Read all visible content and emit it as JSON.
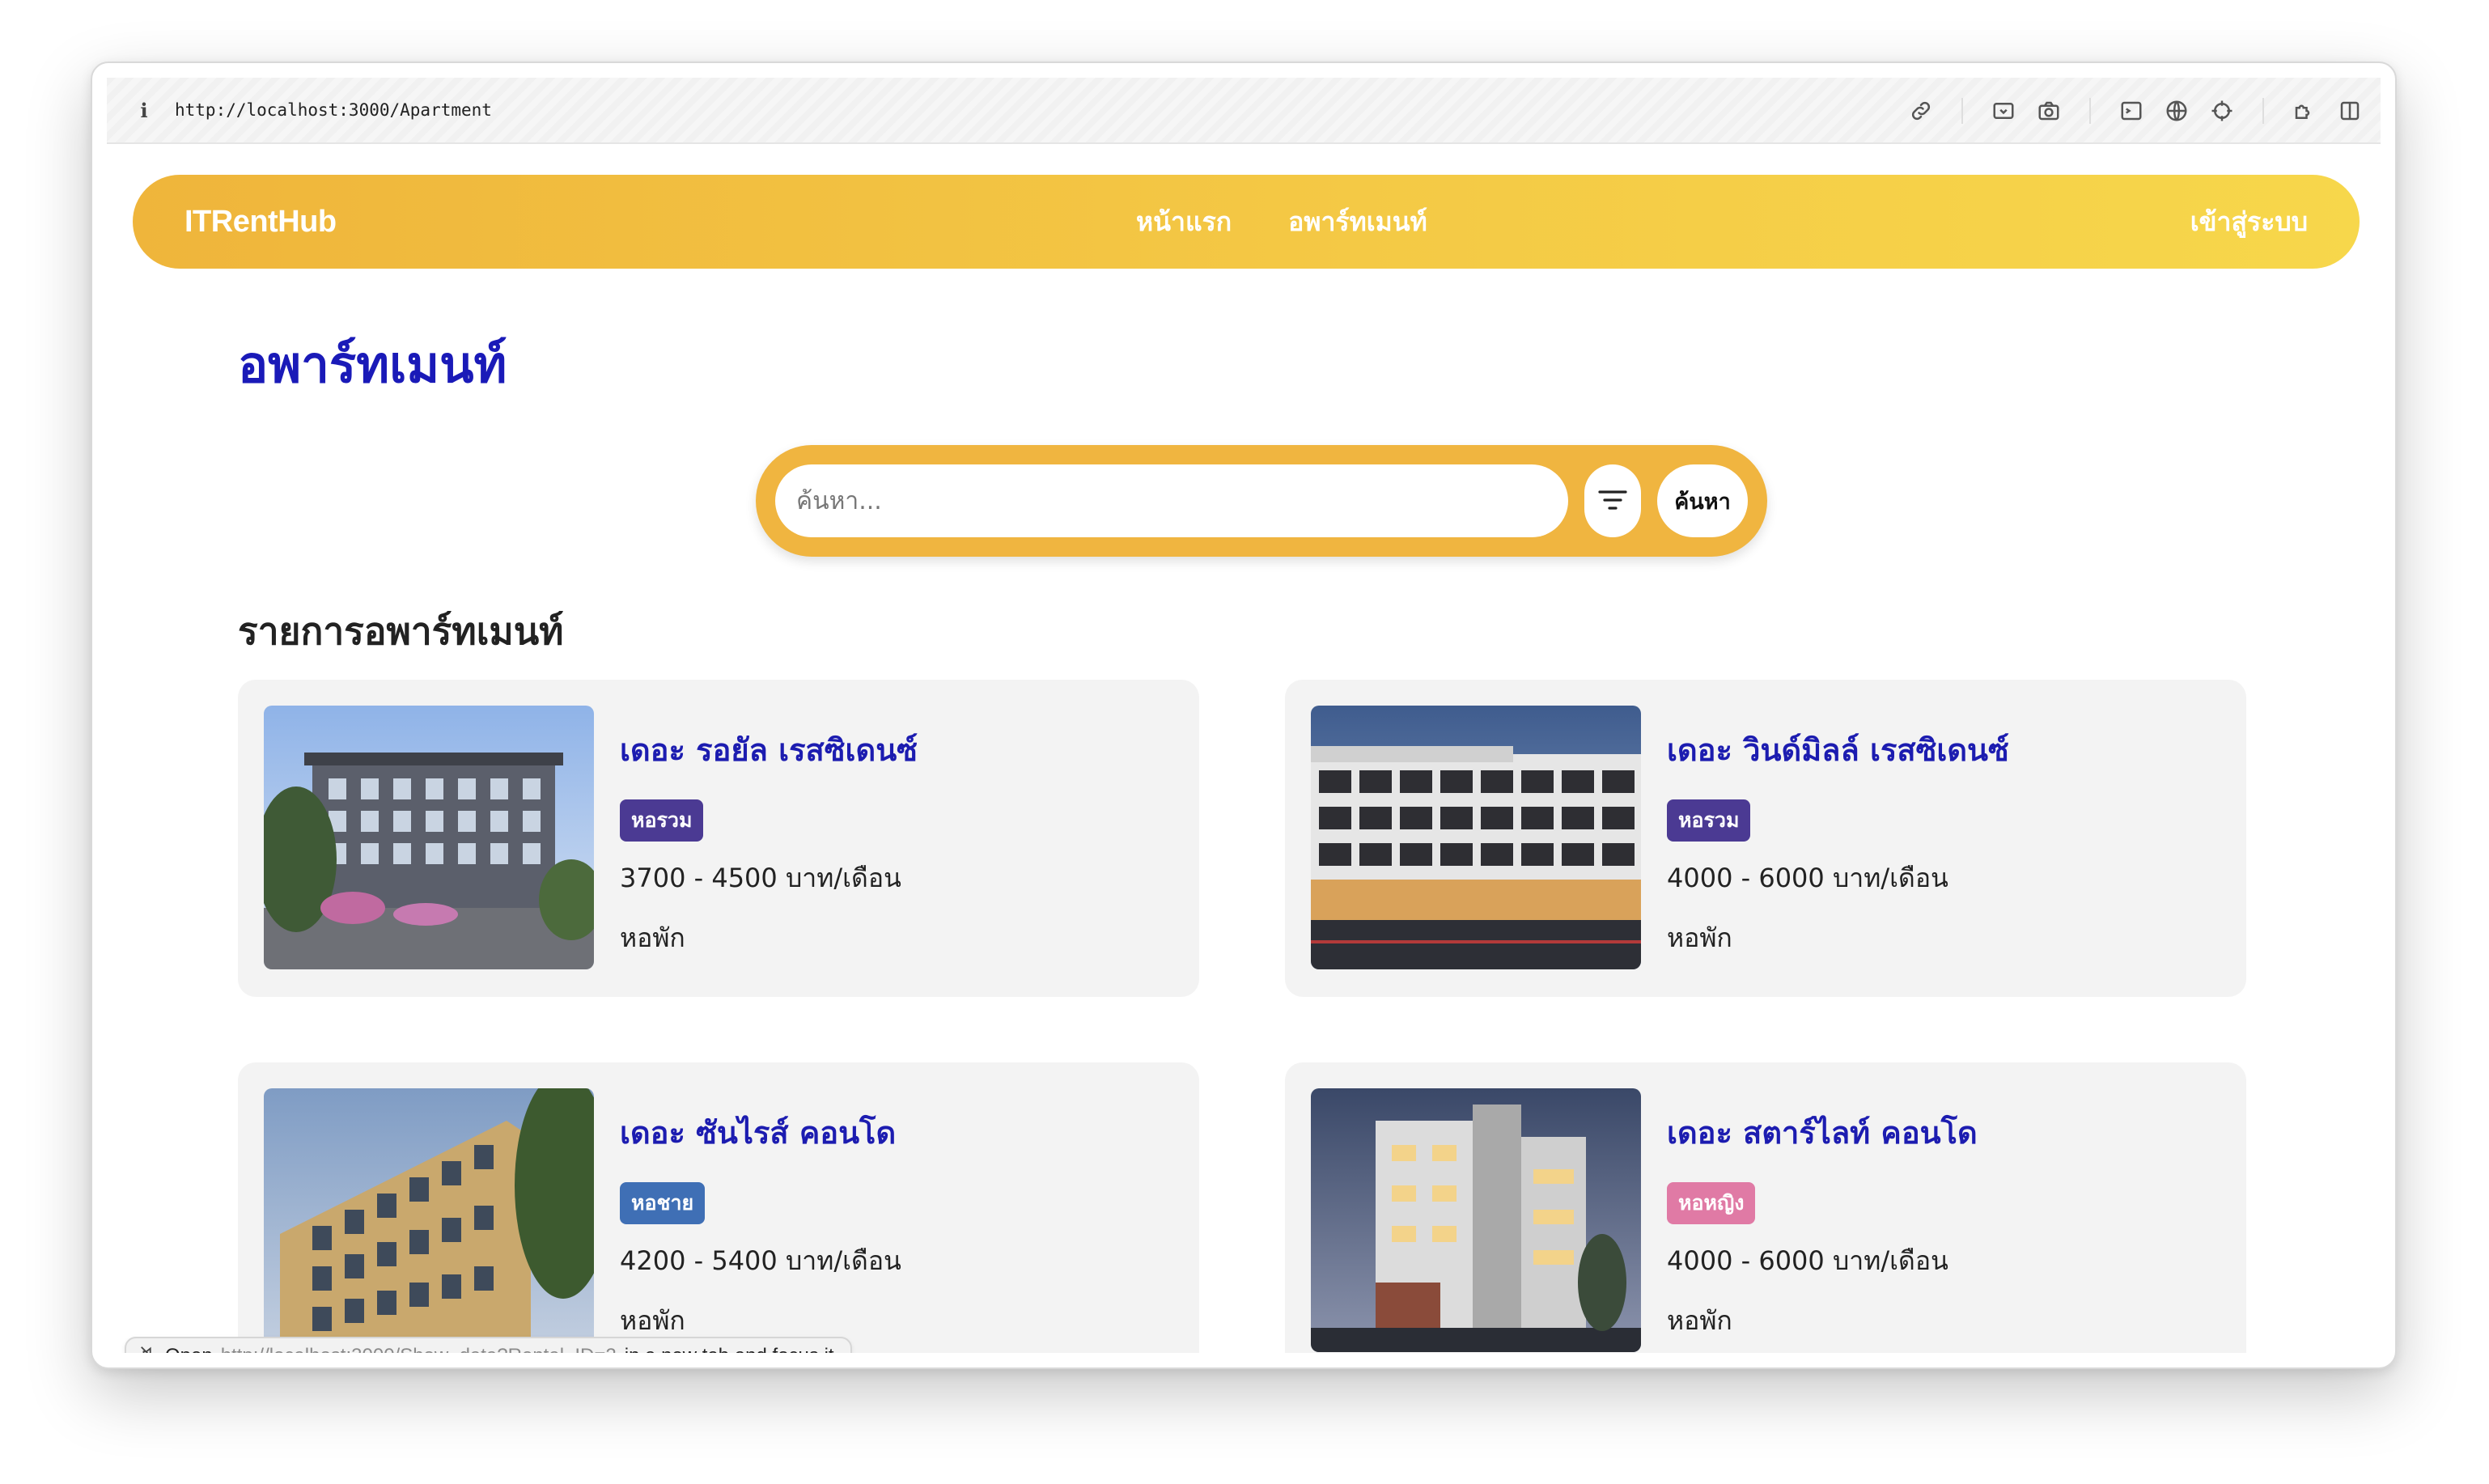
{
  "browser": {
    "url": "http://localhost:3000/Apartment",
    "info_icon": "i"
  },
  "nav": {
    "brand": "ITRentHub",
    "links": [
      "หน้าแรก",
      "อพาร์ทเมนท์"
    ],
    "login": "เข้าสู่ระบบ"
  },
  "page": {
    "title": "อพาร์ทเมนท์",
    "section_title": "รายการอพาร์ทเมนท์"
  },
  "search": {
    "placeholder": "ค้นหา...",
    "button": "ค้นหา"
  },
  "listings": [
    {
      "name": "เดอะ รอยัล เรสซิเดนซ์",
      "badge": "หอรวม",
      "price": "3700 - 4500 บาท/เดือน",
      "type": "หอพัก",
      "badge_color": "#4b3a93"
    },
    {
      "name": "เดอะ วินด์มิลล์ เรสซิเดนซ์",
      "badge": "หอรวม",
      "price": "4000 - 6000 บาท/เดือน",
      "type": "หอพัก",
      "badge_color": "#4b3a93"
    },
    {
      "name": "เดอะ ซันไรส์ คอนโด",
      "badge": "หอชาย",
      "price": "4200 - 5400 บาท/เดือน",
      "type": "หอพัก",
      "badge_color": "#3f6fb5"
    },
    {
      "name": "เดอะ สตาร์ไลท์ คอนโด",
      "badge": "หอหญิง",
      "price": "4000 - 6000 บาท/เดือน",
      "type": "หอพัก",
      "badge_color": "#e07aa5"
    }
  ],
  "status_bar": {
    "prefix": "Open",
    "link": "http://localhost:3000/Show_data?Rental_ID=2",
    "suffix": "in a new tab and focus it"
  },
  "colors": {
    "accent": "#f0b540",
    "title_blue": "#1a1ab8"
  }
}
